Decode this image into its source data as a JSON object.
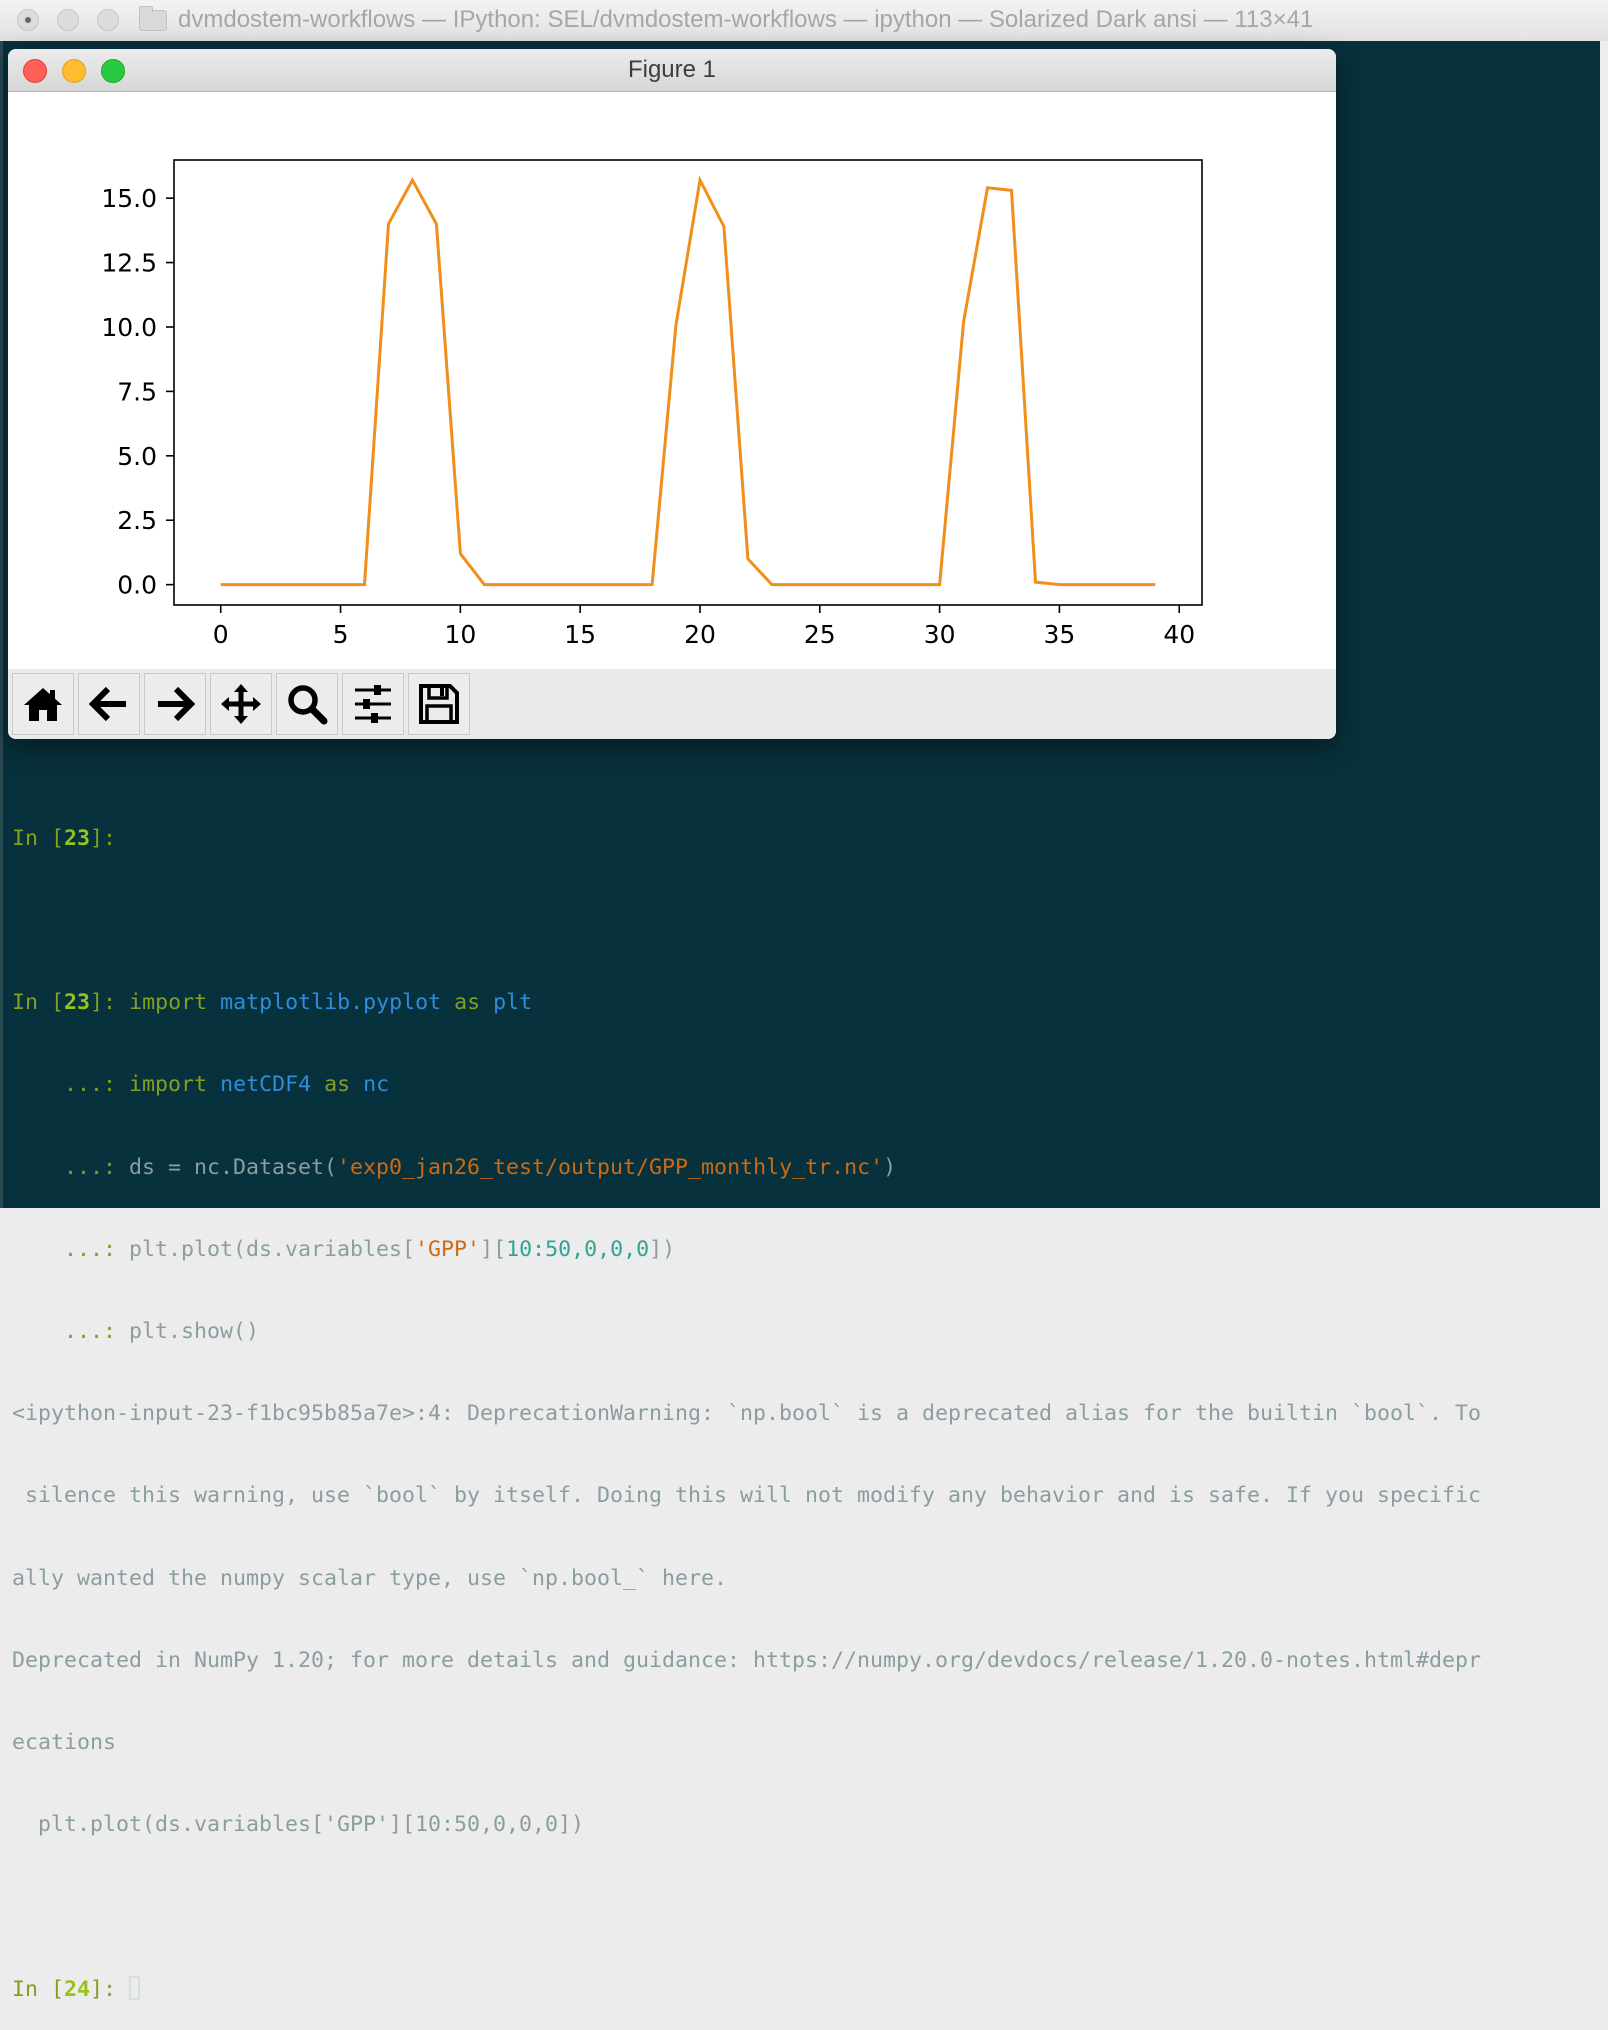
{
  "terminal": {
    "title": "dvmdostem-workflows — IPython: SEL/dvmdostem-workflows — ipython — Solarized Dark ansi — 113×41"
  },
  "figure": {
    "title": "Figure 1"
  },
  "toolbar": {
    "icons": [
      "home-icon",
      "back-arrow-icon",
      "forward-arrow-icon",
      "pan-icon",
      "zoom-icon",
      "configure-subplots-icon",
      "save-icon"
    ]
  },
  "console": {
    "p1_in": "In [",
    "p1_num": "23",
    "p1_close": "]:",
    "p2_in": "In [",
    "p2_num": "23",
    "p2_close": "]:",
    "cont": "    ...:",
    "l1_import": "import",
    "l1_module": "matplotlib.pyplot",
    "l1_as": "as",
    "l1_alias": "plt",
    "l2_import": "import",
    "l2_module": "netCDF4",
    "l2_as": "as",
    "l2_alias": "nc",
    "l3_pre": "ds = nc.Dataset(",
    "l3_str": "'exp0_jan26_test/output/GPP_monthly_tr.nc'",
    "l3_post": ")",
    "l4_pre": "plt.plot(ds.variables[",
    "l4_str": "'GPP'",
    "l4_mid": "][",
    "l4_nums": "10:50,0,0,0",
    "l4_post": "])",
    "l5": "plt.show()",
    "w1": "<ipython-input-23-f1bc95b85a7e>:4: DeprecationWarning: `np.bool` is a deprecated alias for the builtin `bool`. To",
    "w2": " silence this warning, use `bool` by itself. Doing this will not modify any behavior and is safe. If you specific",
    "w3": "ally wanted the numpy scalar type, use `np.bool_` here.",
    "w4": "Deprecated in NumPy 1.20; for more details and guidance: https://numpy.org/devdocs/release/1.20.0-notes.html#depr",
    "w5": "ecations",
    "w6": "  plt.plot(ds.variables['GPP'][10:50,0,0,0])",
    "p3_in": "In [",
    "p3_num": "24",
    "p3_close": "]:"
  },
  "chart_data": {
    "type": "line",
    "x": [
      0,
      1,
      2,
      3,
      4,
      5,
      6,
      7,
      8,
      9,
      10,
      11,
      12,
      13,
      14,
      15,
      16,
      17,
      18,
      19,
      20,
      21,
      22,
      23,
      24,
      25,
      26,
      27,
      28,
      29,
      30,
      31,
      32,
      33,
      34,
      35,
      36,
      37,
      38,
      39
    ],
    "series": [
      {
        "values": [
          0,
          0,
          0,
          0,
          0,
          0,
          0,
          14.0,
          15.7,
          14.0,
          1.2,
          0,
          0,
          0,
          0,
          0,
          0,
          0,
          0,
          10.1,
          15.7,
          13.9,
          1.0,
          0,
          0,
          0,
          0,
          0,
          0,
          0,
          0,
          10.2,
          15.4,
          15.3,
          0.1,
          0,
          0,
          0,
          0,
          0
        ],
        "color": "#f28e1c"
      }
    ],
    "xlim": [
      -1.95,
      40.95
    ],
    "ylim": [
      -0.79,
      16.48
    ],
    "xticks": [
      0,
      5,
      10,
      15,
      20,
      25,
      30,
      35,
      40
    ],
    "yticks": [
      0.0,
      2.5,
      5.0,
      7.5,
      10.0,
      12.5,
      15.0
    ],
    "xtick_labels": [
      "0",
      "5",
      "10",
      "15",
      "20",
      "25",
      "30",
      "35",
      "40"
    ],
    "ytick_labels": [
      "0.0",
      "2.5",
      "5.0",
      "7.5",
      "10.0",
      "12.5",
      "15.0"
    ],
    "title": "",
    "xlabel": "",
    "ylabel": "",
    "grid": false,
    "legend": false
  }
}
